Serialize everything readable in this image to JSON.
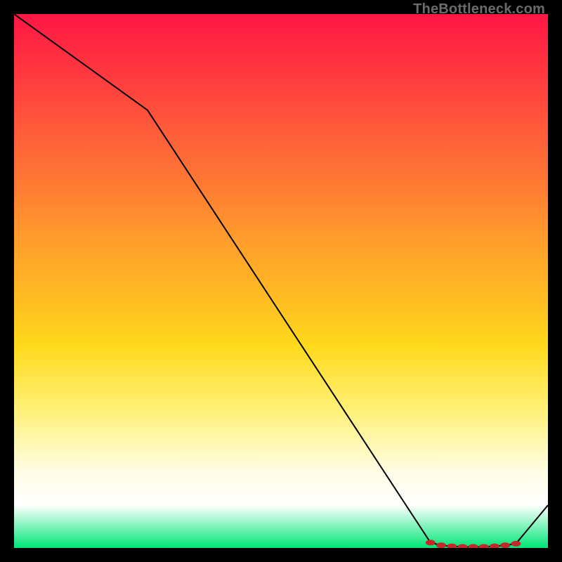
{
  "watermark": "TheBottleneck.com",
  "chart_data": {
    "type": "line",
    "title": "",
    "xlabel": "",
    "ylabel": "",
    "xlim": [
      0,
      100
    ],
    "ylim": [
      0,
      100
    ],
    "x": [
      0,
      25,
      78,
      80,
      82,
      84,
      86,
      88,
      90,
      92,
      94,
      100
    ],
    "values": [
      100,
      82,
      1,
      0.5,
      0.3,
      0.2,
      0.2,
      0.2,
      0.3,
      0.5,
      0.8,
      8
    ],
    "bottleneck_band": {
      "x_start": 78,
      "x_end": 94
    },
    "band_points_x": [
      78,
      80,
      82,
      84,
      86,
      88,
      90,
      92,
      94
    ],
    "band_points_y": [
      1,
      0.5,
      0.3,
      0.2,
      0.2,
      0.2,
      0.3,
      0.5,
      0.8
    ]
  },
  "colors": {
    "gradient_top": "#ff1744",
    "gradient_mid": "#ffeb3b",
    "gradient_bottom": "#00e676",
    "curve": "#000000",
    "dots": "#c62828",
    "frame": "#000000",
    "watermark": "#6b6b6b"
  }
}
